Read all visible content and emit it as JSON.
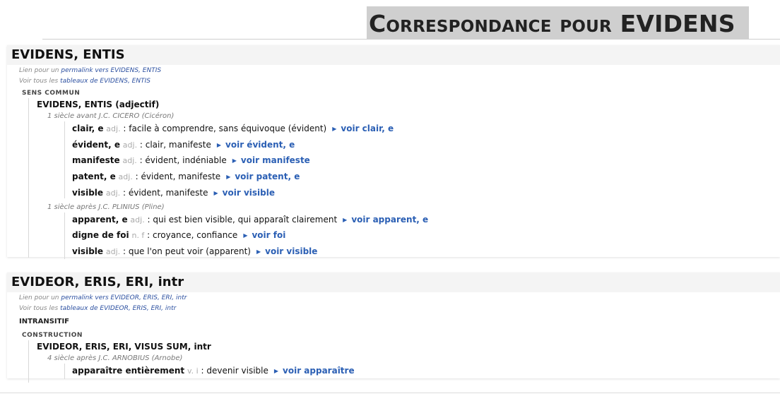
{
  "page": {
    "title": "Correspondance pour EVIDENS"
  },
  "entries": [
    {
      "heading": "EVIDENS, ENTIS",
      "permalink_prefix": "Lien pour un ",
      "permalink_text": "permalink vers EVIDENS, ENTIS",
      "tables_prefix": "Voir tous les ",
      "tables_text": "tableaux de EVIDENS, ENTIS",
      "section": "Sens commun",
      "lemma": "EVIDENS, ENTIS",
      "lemma_pos": "(adjectif)",
      "periods": [
        {
          "label": "1 siècle avant J.C. CICERO (Cicéron)",
          "defs": [
            {
              "word": "clair, e",
              "gram": "adj.",
              "def": " : facile à comprendre, sans équivoque (évident)",
              "link": "voir clair, e"
            },
            {
              "word": "évident, e",
              "gram": "adj.",
              "def": " : clair, manifeste",
              "link": "voir évident, e"
            },
            {
              "word": "manifeste",
              "gram": "adj.",
              "def": " : évident, indéniable",
              "link": "voir manifeste"
            },
            {
              "word": "patent, e",
              "gram": "adj.",
              "def": " : évident, manifeste",
              "link": "voir patent, e"
            },
            {
              "word": "visible",
              "gram": "adj.",
              "def": " : évident, manifeste",
              "link": "voir visible"
            }
          ]
        },
        {
          "label": "1 siècle après J.C. PLINIUS (Pline)",
          "defs": [
            {
              "word": "apparent, e",
              "gram": "adj.",
              "def": " : qui est bien visible, qui apparaît clairement",
              "link": "voir apparent, e"
            },
            {
              "word": "digne de foi",
              "gram": "n. f",
              "def": " : croyance, confiance",
              "link": "voir foi"
            },
            {
              "word": "visible",
              "gram": "adj.",
              "def": " : que l'on peut voir (apparent)",
              "link": "voir visible"
            }
          ]
        }
      ]
    },
    {
      "heading": "EVIDEOR, ERIS, ERI, intr",
      "permalink_prefix": "Lien pour un ",
      "permalink_text": "permalink vers EVIDEOR, ERIS, ERI, intr",
      "tables_prefix": "Voir tous les ",
      "tables_text": "tableaux de EVIDEOR, ERIS, ERI, intr",
      "category": "Intransitif",
      "section": "Construction",
      "lemma": "EVIDEOR, ERIS, ERI, VISUS SUM, intr",
      "periods": [
        {
          "label": "4 siècle après J.C. ARNOBIUS (Arnobe)",
          "defs": [
            {
              "word": "apparaître entièrement",
              "gram": "v. i",
              "def": " : devenir visible",
              "link": "voir apparaître"
            }
          ]
        }
      ]
    }
  ],
  "colors": {
    "link": "#2b5fb4",
    "heading_bg": "#f4f4f4",
    "title_bg": "#cfcfcf"
  }
}
